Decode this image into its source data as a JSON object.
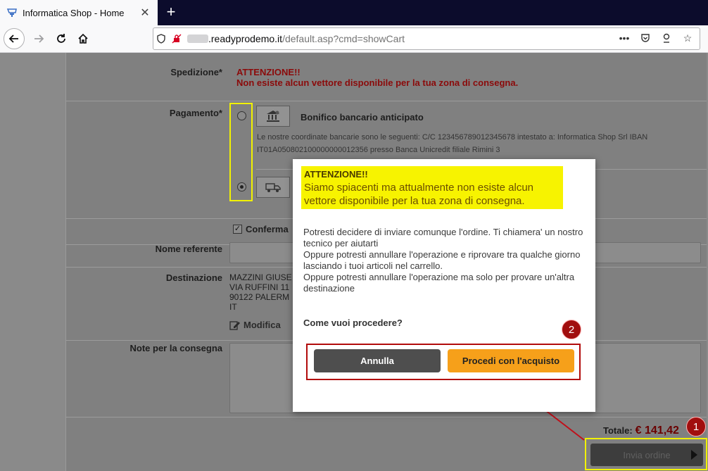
{
  "browser": {
    "tab_title": "Informatica Shop - Home",
    "new_tab_label": "+",
    "url_domain": ".readyprodemo.it",
    "url_path": "/default.asp?cmd=showCart"
  },
  "icons": {
    "favicon": "shop-favicon-icon",
    "close": "close-icon",
    "back": "back-arrow-icon",
    "forward": "forward-arrow-icon",
    "reload": "reload-icon",
    "home": "home-icon",
    "shield": "shield-icon",
    "no_tracking": "tracking-blocked-icon",
    "more": "more-dots-icon",
    "pocket": "pocket-icon",
    "reader": "reader-icon",
    "bookmark": "star-icon",
    "bank": "bank-icon",
    "truck": "truck-icon",
    "edit": "edit-icon",
    "play": "play-icon"
  },
  "form": {
    "spedizione_label": "Spedizione*",
    "spedizione_warn_title": "ATTENZIONE!!",
    "spedizione_warn_text": "Non esiste alcun vettore disponibile per la tua zona di consegna.",
    "pagamento_label": "Pagamento*",
    "bonifico_title": "Bonifico bancario anticipato",
    "bonifico_desc": "Le nostre coordinate bancarie sono le seguenti: C/C 123456789012345678 intestato a: Informatica Shop Srl IBAN IT01A050802100000000012356 presso Banca Unicredit filiale Rimini 3",
    "conferma_label": "Conferma",
    "nome_referente_label": "Nome referente",
    "destinazione_label": "Destinazione",
    "destinazione_text": "MAZZINI GIUSE\nVIA RUFFINI 11\n90122 PALERM\nIT",
    "modifica_label": "Modifica",
    "note_label": "Note per la consegna",
    "totale_label": "Totale:",
    "totale_amount": "€ 141,42",
    "invia_label": "Invia ordine"
  },
  "modal": {
    "alert_title": "ATTENZIONE!!",
    "alert_text": "Siamo spiacenti ma attualmente non esiste alcun vettore disponibile per la tua zona di consegna.",
    "body_line1": "Potresti decidere di inviare comunque l'ordine. Ti chiamera' un nostro tecnico per aiutarti",
    "body_line2": "Oppure potresti annullare l'operazione e riprovare tra qualche giorno lasciando i tuoi articoli nel carrello.",
    "body_line3": "Oppure potresti annullare l'operazione ma solo per provare un'altra destinazione",
    "question": "Come vuoi procedere?",
    "annulla_label": "Annulla",
    "procedi_label": "Procedi con l'acquisto"
  },
  "annotations": {
    "badge_1": "1",
    "badge_2": "2"
  },
  "colors": {
    "highlight_yellow": "#f2f200",
    "annotation_red": "#b20b0b",
    "procedi_orange": "#f6a01a",
    "alert_yellow": "#f7f300"
  }
}
